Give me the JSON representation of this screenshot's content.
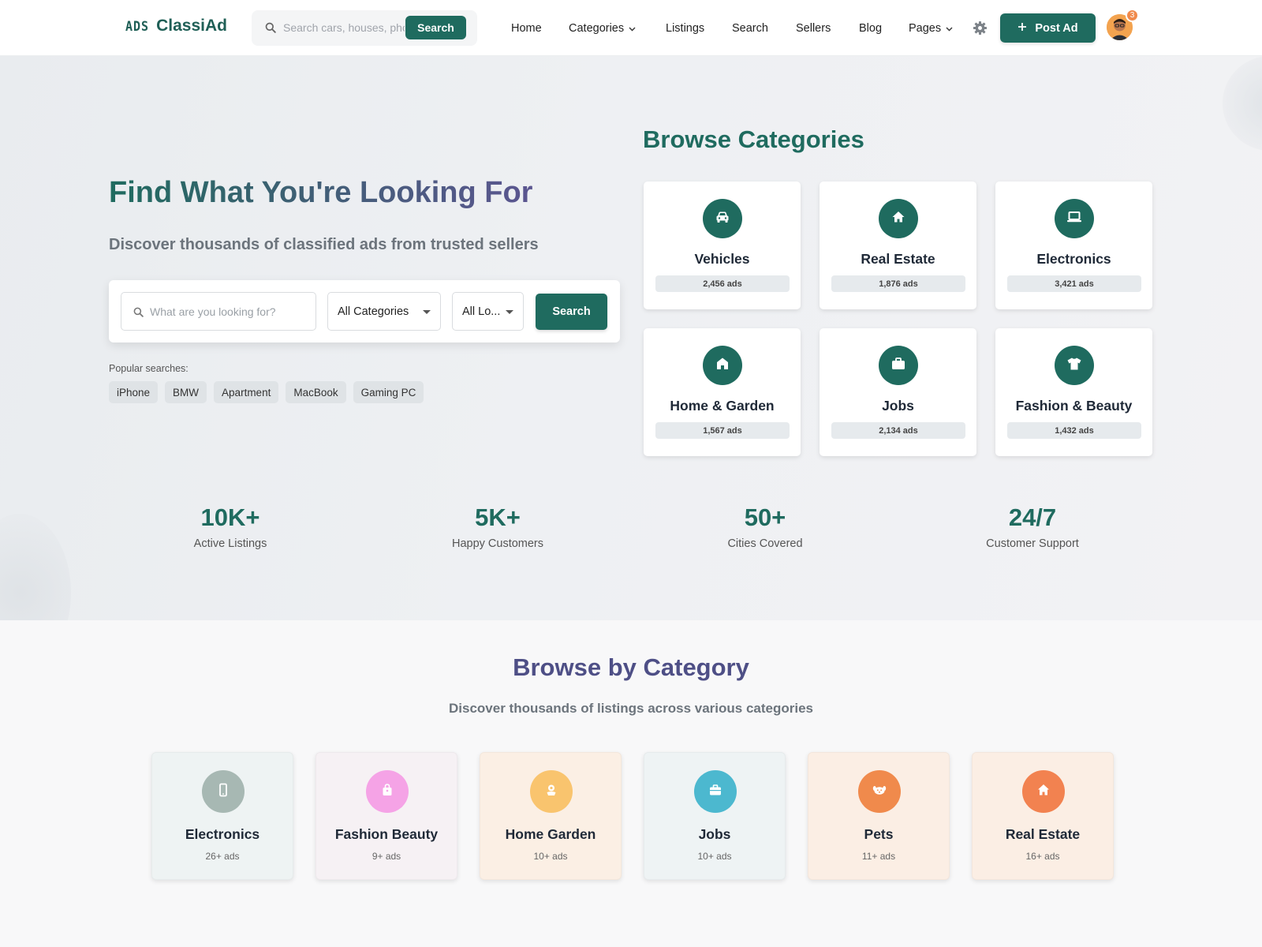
{
  "header": {
    "logo_mark": "ADS",
    "logo_text": "ClassiAd",
    "search_placeholder": "Search cars, houses, phones...",
    "search_button": "Search",
    "nav": [
      {
        "label": "Home",
        "dropdown": false
      },
      {
        "label": "Categories",
        "dropdown": true
      },
      {
        "label": "Listings",
        "dropdown": false
      },
      {
        "label": "Search",
        "dropdown": false
      },
      {
        "label": "Sellers",
        "dropdown": false
      },
      {
        "label": "Blog",
        "dropdown": false
      },
      {
        "label": "Pages",
        "dropdown": true
      }
    ],
    "post_ad": "Post Ad",
    "notification_count": "3"
  },
  "hero": {
    "title": "Find What You're Looking For",
    "subtitle": "Discover thousands of classified ads from trusted sellers",
    "search_placeholder": "What are you looking for?",
    "category_select": "All Categories",
    "location_select": "All Lo...",
    "search_button": "Search",
    "popular_label": "Popular searches:",
    "popular": [
      "iPhone",
      "BMW",
      "Apartment",
      "MacBook",
      "Gaming PC"
    ]
  },
  "browse_categories": {
    "title": "Browse Categories",
    "items": [
      {
        "name": "Vehicles",
        "count": "2,456 ads",
        "icon": "car-icon"
      },
      {
        "name": "Real Estate",
        "count": "1,876 ads",
        "icon": "home-icon"
      },
      {
        "name": "Electronics",
        "count": "3,421 ads",
        "icon": "laptop-icon"
      },
      {
        "name": "Home & Garden",
        "count": "1,567 ads",
        "icon": "house-icon"
      },
      {
        "name": "Jobs",
        "count": "2,134 ads",
        "icon": "briefcase-icon"
      },
      {
        "name": "Fashion & Beauty",
        "count": "1,432 ads",
        "icon": "shirt-icon"
      }
    ]
  },
  "stats": [
    {
      "value": "10K+",
      "label": "Active Listings"
    },
    {
      "value": "5K+",
      "label": "Happy Customers"
    },
    {
      "value": "50+",
      "label": "Cities Covered"
    },
    {
      "value": "24/7",
      "label": "Customer Support"
    }
  ],
  "browse_by_category": {
    "title": "Browse by Category",
    "subtitle": "Discover thousands of listings across various categories",
    "items": [
      {
        "name": "Electronics",
        "count": "26+ ads",
        "icon": "phone-icon",
        "color": "#a7b8b3",
        "bg": "#eef3f3"
      },
      {
        "name": "Fashion Beauty",
        "count": "9+ ads",
        "icon": "bag-icon",
        "color": "#f5a3e6",
        "bg": "#f6f1f4"
      },
      {
        "name": "Home Garden",
        "count": "10+ ads",
        "icon": "flower-icon",
        "color": "#f9c46e",
        "bg": "#fbefe4"
      },
      {
        "name": "Jobs",
        "count": "10+ ads",
        "icon": "briefcase-icon",
        "color": "#4cb8cf",
        "bg": "#eef3f4"
      },
      {
        "name": "Pets",
        "count": "11+ ads",
        "icon": "paw-icon",
        "color": "#f08a4c",
        "bg": "#fbeee4"
      },
      {
        "name": "Real Estate",
        "count": "16+ ads",
        "icon": "home-icon",
        "color": "#f28250",
        "bg": "#fbeee4"
      }
    ]
  }
}
